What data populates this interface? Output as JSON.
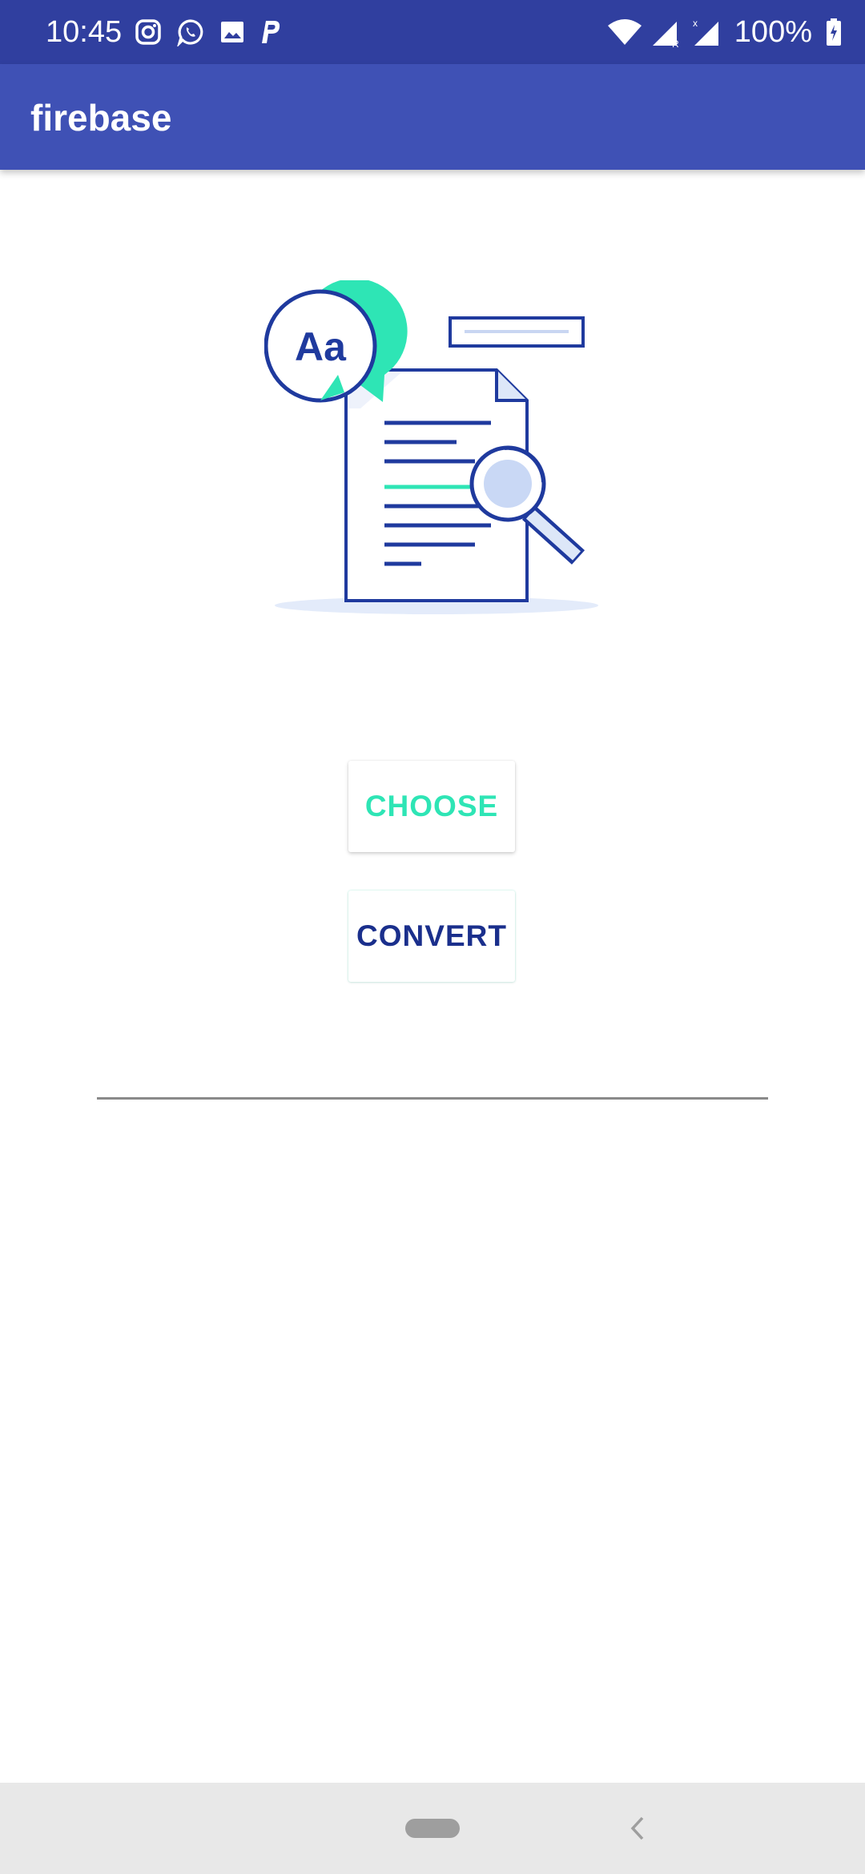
{
  "status_bar": {
    "time": "10:45",
    "left_icons": [
      "instagram-icon",
      "whatsapp-icon",
      "image-icon",
      "paypal-icon"
    ],
    "right_icons": [
      "wifi-icon",
      "cell-signal-icon",
      "cell-signal-icon"
    ],
    "battery": "100%"
  },
  "app_bar": {
    "title": "firebase"
  },
  "illustration": {
    "badge_text": "Aa",
    "icon": "document-search-illustration"
  },
  "buttons": {
    "choose_label": "CHOOSE",
    "convert_label": "CONVERT"
  },
  "output": {
    "value": ""
  },
  "nav_bar": {
    "icons": [
      "home-pill-icon",
      "back-icon"
    ]
  },
  "colors": {
    "status_bar": "#303f9f",
    "app_bar": "#3f51b5",
    "choose_text": "#2ee5b5",
    "convert_text": "#1a2f8c",
    "illustration_stroke": "#1f3a9e",
    "illustration_accent": "#2ee5b5",
    "nav_bar": "#e8e8e8"
  }
}
